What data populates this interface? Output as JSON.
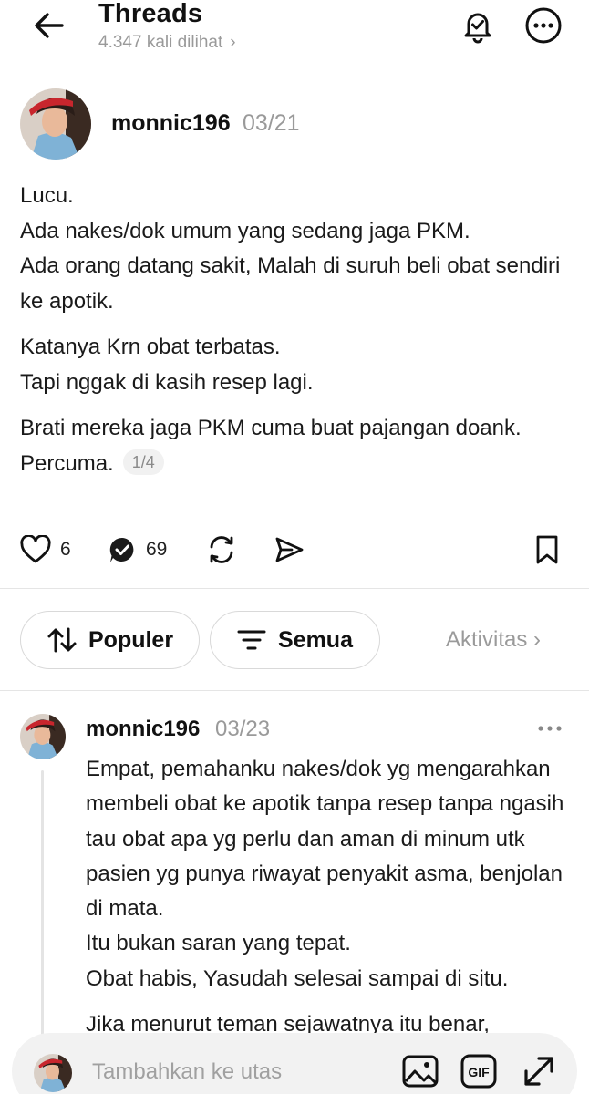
{
  "header": {
    "title": "Threads",
    "views": "4.347 kali dilihat",
    "views_chevron": "›",
    "back_icon": "arrow-left-icon",
    "bell_icon": "bell-check-icon",
    "more_icon": "more-circle-icon"
  },
  "post": {
    "username": "monnic196",
    "date": "03/21",
    "paragraphs": [
      [
        "Lucu.",
        "Ada nakes/dok umum yang sedang jaga PKM.",
        "Ada orang datang sakit, Malah di suruh beli obat sendiri ke apotik."
      ],
      [
        "Katanya Krn obat terbatas.",
        "Tapi nggak di kasih resep lagi."
      ],
      [
        "Brati mereka jaga PKM cuma buat pajangan doank.",
        "Percuma."
      ]
    ],
    "page_indicator": "1/4",
    "likes": "6",
    "replies": "69"
  },
  "filters": {
    "popular_label": "Populer",
    "all_label": "Semua",
    "activity_label": "Aktivitas",
    "activity_chevron": "›"
  },
  "reply": {
    "username": "monnic196",
    "date": "03/23",
    "paragraphs": [
      [
        "Empat, pemahanku nakes/dok yg mengarahkan membeli obat ke apotik tanpa resep tanpa ngasih tau obat apa yg perlu dan aman di minum utk pasien yg punya riwayat penyakit asma, benjolan di mata.",
        "Itu bukan saran yang tepat.",
        "Obat habis, Yasudah selesai sampai di situ."
      ],
      [
        "Jika menurut teman sejawatnya itu benar,"
      ]
    ]
  },
  "composer": {
    "placeholder": "Tambahkan ke utas",
    "gif_label": "GIF"
  },
  "colors": {
    "muted": "#9a9a9a",
    "border": "#d9d9d9",
    "composer_bg": "#f2f2f2",
    "avatar_hat": "#c8262d",
    "avatar_shirt": "#7fb2d6"
  }
}
